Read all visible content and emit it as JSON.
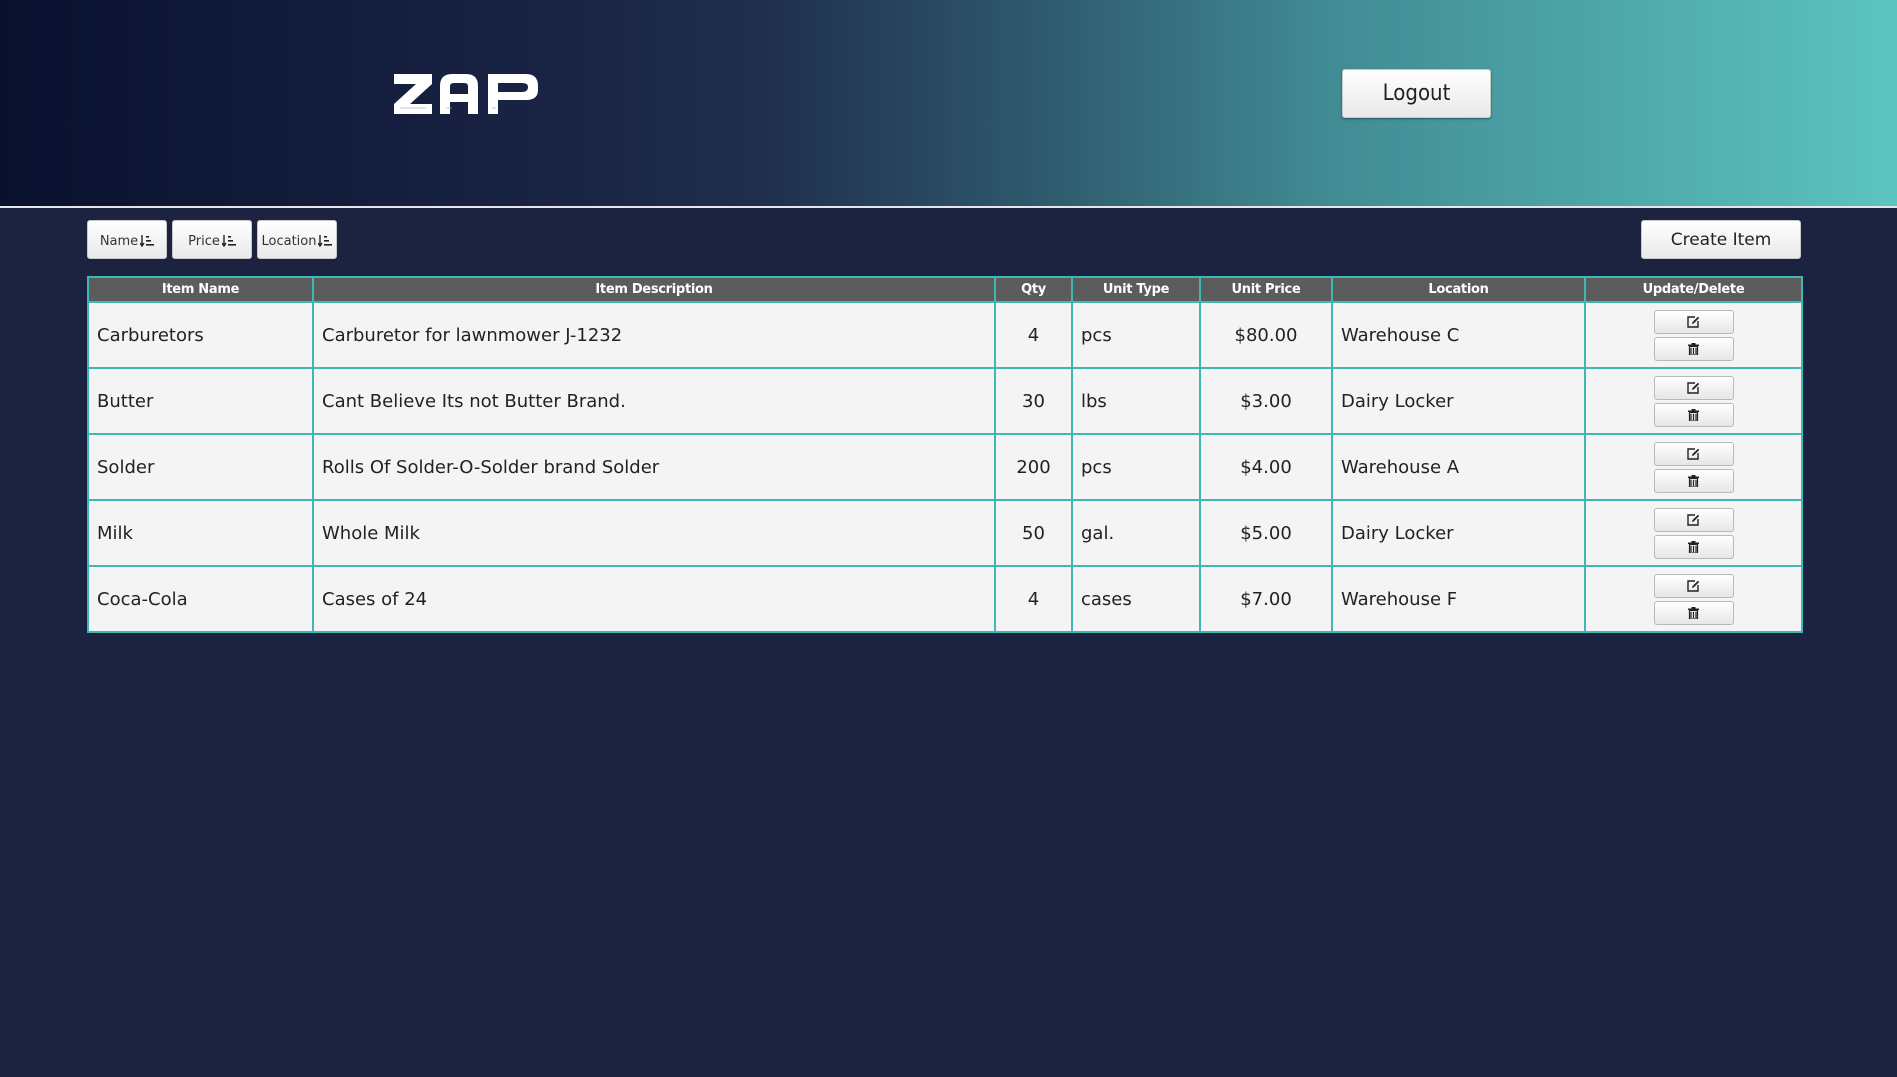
{
  "header": {
    "logo_text": "ZAP",
    "logout_label": "Logout"
  },
  "sort": {
    "name_label": "Name",
    "price_label": "Price",
    "location_label": "Location"
  },
  "toolbar": {
    "create_label": "Create Item"
  },
  "table": {
    "columns": [
      "Item Name",
      "Item Description",
      "Qty",
      "Unit Type",
      "Unit Price",
      "Location",
      "Update/Delete"
    ],
    "rows": [
      [
        "Carburetors",
        "Carburetor for lawnmower J-1232",
        "4",
        "pcs",
        "$80.00",
        "Warehouse C"
      ],
      [
        "Butter",
        "Cant Believe Its not Butter Brand.",
        "30",
        "lbs",
        "$3.00",
        "Dairy Locker"
      ],
      [
        "Solder",
        "Rolls Of Solder-O-Solder brand Solder",
        "200",
        "pcs",
        "$4.00",
        "Warehouse A"
      ],
      [
        "Milk",
        "Whole Milk",
        "50",
        "gal.",
        "$5.00",
        "Dairy Locker"
      ],
      [
        "Coca-Cola",
        "Cases of 24",
        "4",
        "cases",
        "$7.00",
        "Warehouse F"
      ]
    ]
  },
  "icons": {
    "sort": "sort-amount-icon",
    "edit": "edit-icon",
    "delete": "trash-icon"
  },
  "colors": {
    "accent": "#3fb8b3",
    "header_start": "#0a1130",
    "header_end": "#5cc4bf",
    "background": "#1b2340",
    "table_header": "#5c5c5c"
  }
}
